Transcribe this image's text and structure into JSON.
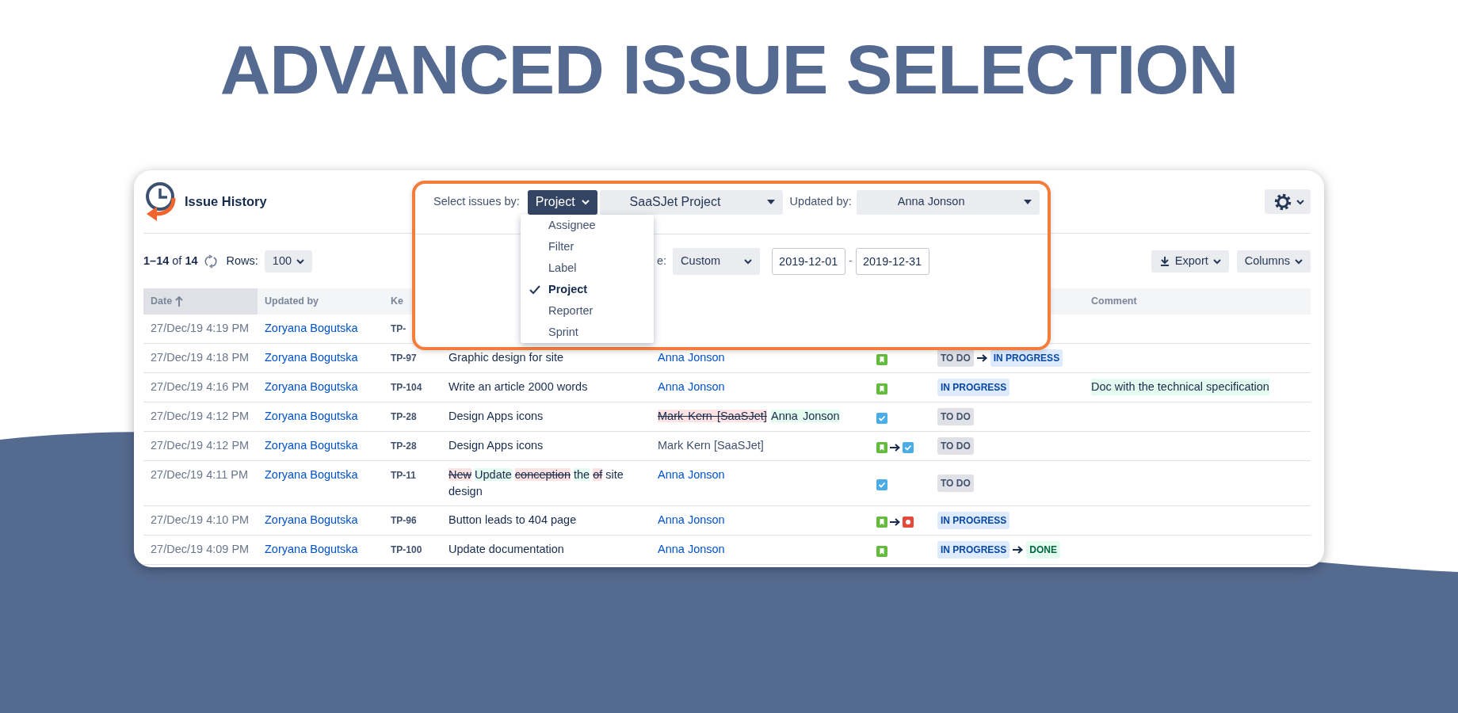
{
  "headline": "ADVANCED ISSUE SELECTION",
  "app": {
    "title": "Issue History"
  },
  "filter_panel": {
    "select_label": "Select issues by:",
    "select_by": "Project",
    "project": "SaaSJet Project",
    "updated_by_label": "Updated by:",
    "updated_by": "Anna Jonson",
    "menu": [
      {
        "label": "Assignee",
        "selected": false
      },
      {
        "label": "Filter",
        "selected": false
      },
      {
        "label": "Label",
        "selected": false
      },
      {
        "label": "Project",
        "selected": true
      },
      {
        "label": "Reporter",
        "selected": false
      },
      {
        "label": "Sprint",
        "selected": false
      }
    ],
    "date_label": "e:",
    "date_mode": "Custom",
    "date_from": "2019-12-01",
    "date_separator": "-",
    "date_to": "2019-12-31"
  },
  "toolbar": {
    "count": "**1–14** of **14**",
    "rows_label": "Rows:",
    "rows": "100",
    "export": "Export",
    "columns": "Columns"
  },
  "table": {
    "columns": [
      {
        "label": "Date",
        "sorted": true
      },
      {
        "label": "Updated by",
        "sorted": false
      },
      {
        "label": "Ke",
        "sorted": false
      },
      {
        "label": "Comment",
        "sorted": false
      }
    ],
    "rows": [
      {
        "date": "27/Dec/19 4:19 PM",
        "updated_by": "Zoryana Bogutska",
        "key": "TP-"
      },
      {
        "date": "27/Dec/19 4:18 PM",
        "updated_by": "Zoryana Bogutska",
        "key": "TP-97",
        "summary": [
          {
            "text": "Graphic design for site"
          }
        ],
        "assignee": {
          "kind": "link",
          "text": "Anna Jonson"
        },
        "types": [
          {
            "kind": "story"
          }
        ],
        "statuses": [
          {
            "label": "TO DO",
            "kind": "todo"
          },
          {
            "label": "IN PROGRESS",
            "kind": "inprogress"
          }
        ]
      },
      {
        "date": "27/Dec/19 4:16 PM",
        "updated_by": "Zoryana Bogutska",
        "key": "TP-104",
        "summary": [
          {
            "text": "Write an article 2000 words"
          }
        ],
        "assignee": {
          "kind": "link",
          "text": "Anna Jonson"
        },
        "types": [
          {
            "kind": "story"
          }
        ],
        "statuses": [
          {
            "label": "IN PROGRESS",
            "kind": "inprogress"
          }
        ],
        "comment": {
          "text": "Doc with the technical specification",
          "highlighted": true
        }
      },
      {
        "date": "27/Dec/19 4:12 PM",
        "updated_by": "Zoryana Bogutska",
        "key": "TP-28",
        "summary": [
          {
            "text": "Design Apps icons"
          }
        ],
        "assignee": {
          "kind": "diff",
          "segments": [
            {
              "text": "Mark Kern [SaaSJet]",
              "removed": true
            },
            {
              "text": "Anna Jonson",
              "added": true
            }
          ]
        },
        "types": [
          {
            "kind": "task"
          }
        ],
        "statuses": [
          {
            "label": "TO DO",
            "kind": "todo"
          }
        ]
      },
      {
        "date": "27/Dec/19 4:12 PM",
        "updated_by": "Zoryana Bogutska",
        "key": "TP-28",
        "summary": [
          {
            "text": "Design Apps icons"
          }
        ],
        "assignee": {
          "kind": "plain",
          "text": "Mark Kern [SaaSJet]"
        },
        "types": [
          {
            "kind": "story"
          },
          {
            "kind": "task"
          }
        ],
        "statuses": [
          {
            "label": "TO DO",
            "kind": "todo"
          }
        ]
      },
      {
        "date": "27/Dec/19 4:11 PM",
        "updated_by": "Zoryana Bogutska",
        "key": "TP-11",
        "summary": [
          {
            "text": "New",
            "removed": true
          },
          {
            "text": "Update",
            "added": true
          },
          {
            "text": "conception",
            "removed": true
          },
          {
            "text": "the",
            "added": true
          },
          {
            "text": "of",
            "removed": true
          },
          {
            "text": "site design"
          }
        ],
        "assignee": {
          "kind": "link",
          "text": "Anna Jonson"
        },
        "types": [
          {
            "kind": "task"
          }
        ],
        "statuses": [
          {
            "label": "TO DO",
            "kind": "todo"
          }
        ]
      },
      {
        "date": "27/Dec/19 4:10 PM",
        "updated_by": "Zoryana Bogutska",
        "key": "TP-96",
        "summary": [
          {
            "text": "Button leads to 404 page"
          }
        ],
        "assignee": {
          "kind": "link",
          "text": "Anna Jonson"
        },
        "types": [
          {
            "kind": "story"
          },
          {
            "kind": "bug"
          }
        ],
        "statuses": [
          {
            "label": "IN PROGRESS",
            "kind": "inprogress"
          }
        ]
      },
      {
        "date": "27/Dec/19 4:09 PM",
        "updated_by": "Zoryana Bogutska",
        "key": "TP-100",
        "summary": [
          {
            "text": "Update documentation"
          }
        ],
        "assignee": {
          "kind": "link",
          "text": "Anna Jonson"
        },
        "types": [
          {
            "kind": "story"
          }
        ],
        "statuses": [
          {
            "label": "IN PROGRESS",
            "kind": "inprogress"
          },
          {
            "label": "DONE",
            "kind": "done"
          }
        ]
      }
    ]
  }
}
